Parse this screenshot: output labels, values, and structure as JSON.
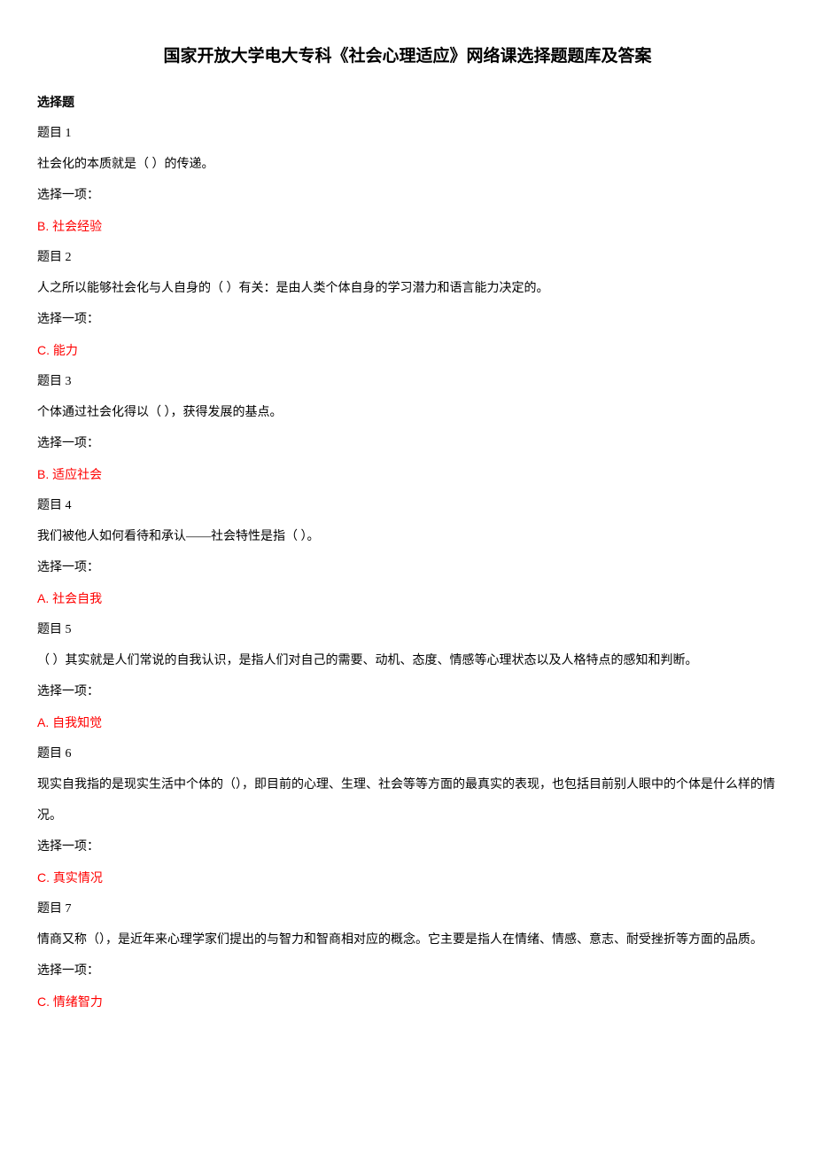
{
  "title": "国家开放大学电大专科《社会心理适应》网络课选择题题库及答案",
  "sectionHeader": "选择题",
  "questions": [
    {
      "num": "题目 1",
      "text": "社会化的本质就是（ ）的传递。",
      "prompt": "选择一项：",
      "answer": "B. 社会经验"
    },
    {
      "num": "题目 2",
      "text": "人之所以能够社会化与人自身的（ ）有关：是由人类个体自身的学习潜力和语言能力决定的。",
      "prompt": "选择一项：",
      "answer": "C. 能力"
    },
    {
      "num": "题目 3",
      "text": "个体通过社会化得以（ ），获得发展的基点。",
      "prompt": "选择一项：",
      "answer": "B. 适应社会"
    },
    {
      "num": "题目 4",
      "text": "我们被他人如何看待和承认——社会特性是指（ ）。",
      "prompt": "选择一项：",
      "answer": "A. 社会自我"
    },
    {
      "num": "题目 5",
      "text": "（ ）其实就是人们常说的自我认识，是指人们对自己的需要、动机、态度、情感等心理状态以及人格特点的感知和判断。",
      "prompt": "选择一项：",
      "answer": "A. 自我知觉"
    },
    {
      "num": "题目 6",
      "text": "现实自我指的是现实生活中个体的（），即目前的心理、生理、社会等等方面的最真实的表现，也包括目前别人眼中的个体是什么样的情况。",
      "prompt": "选择一项：",
      "answer": "C. 真实情况"
    },
    {
      "num": "题目 7",
      "text": "情商又称（），是近年来心理学家们提出的与智力和智商相对应的概念。它主要是指人在情绪、情感、意志、耐受挫折等方面的品质。",
      "prompt": "选择一项：",
      "answer": "C. 情绪智力"
    }
  ]
}
